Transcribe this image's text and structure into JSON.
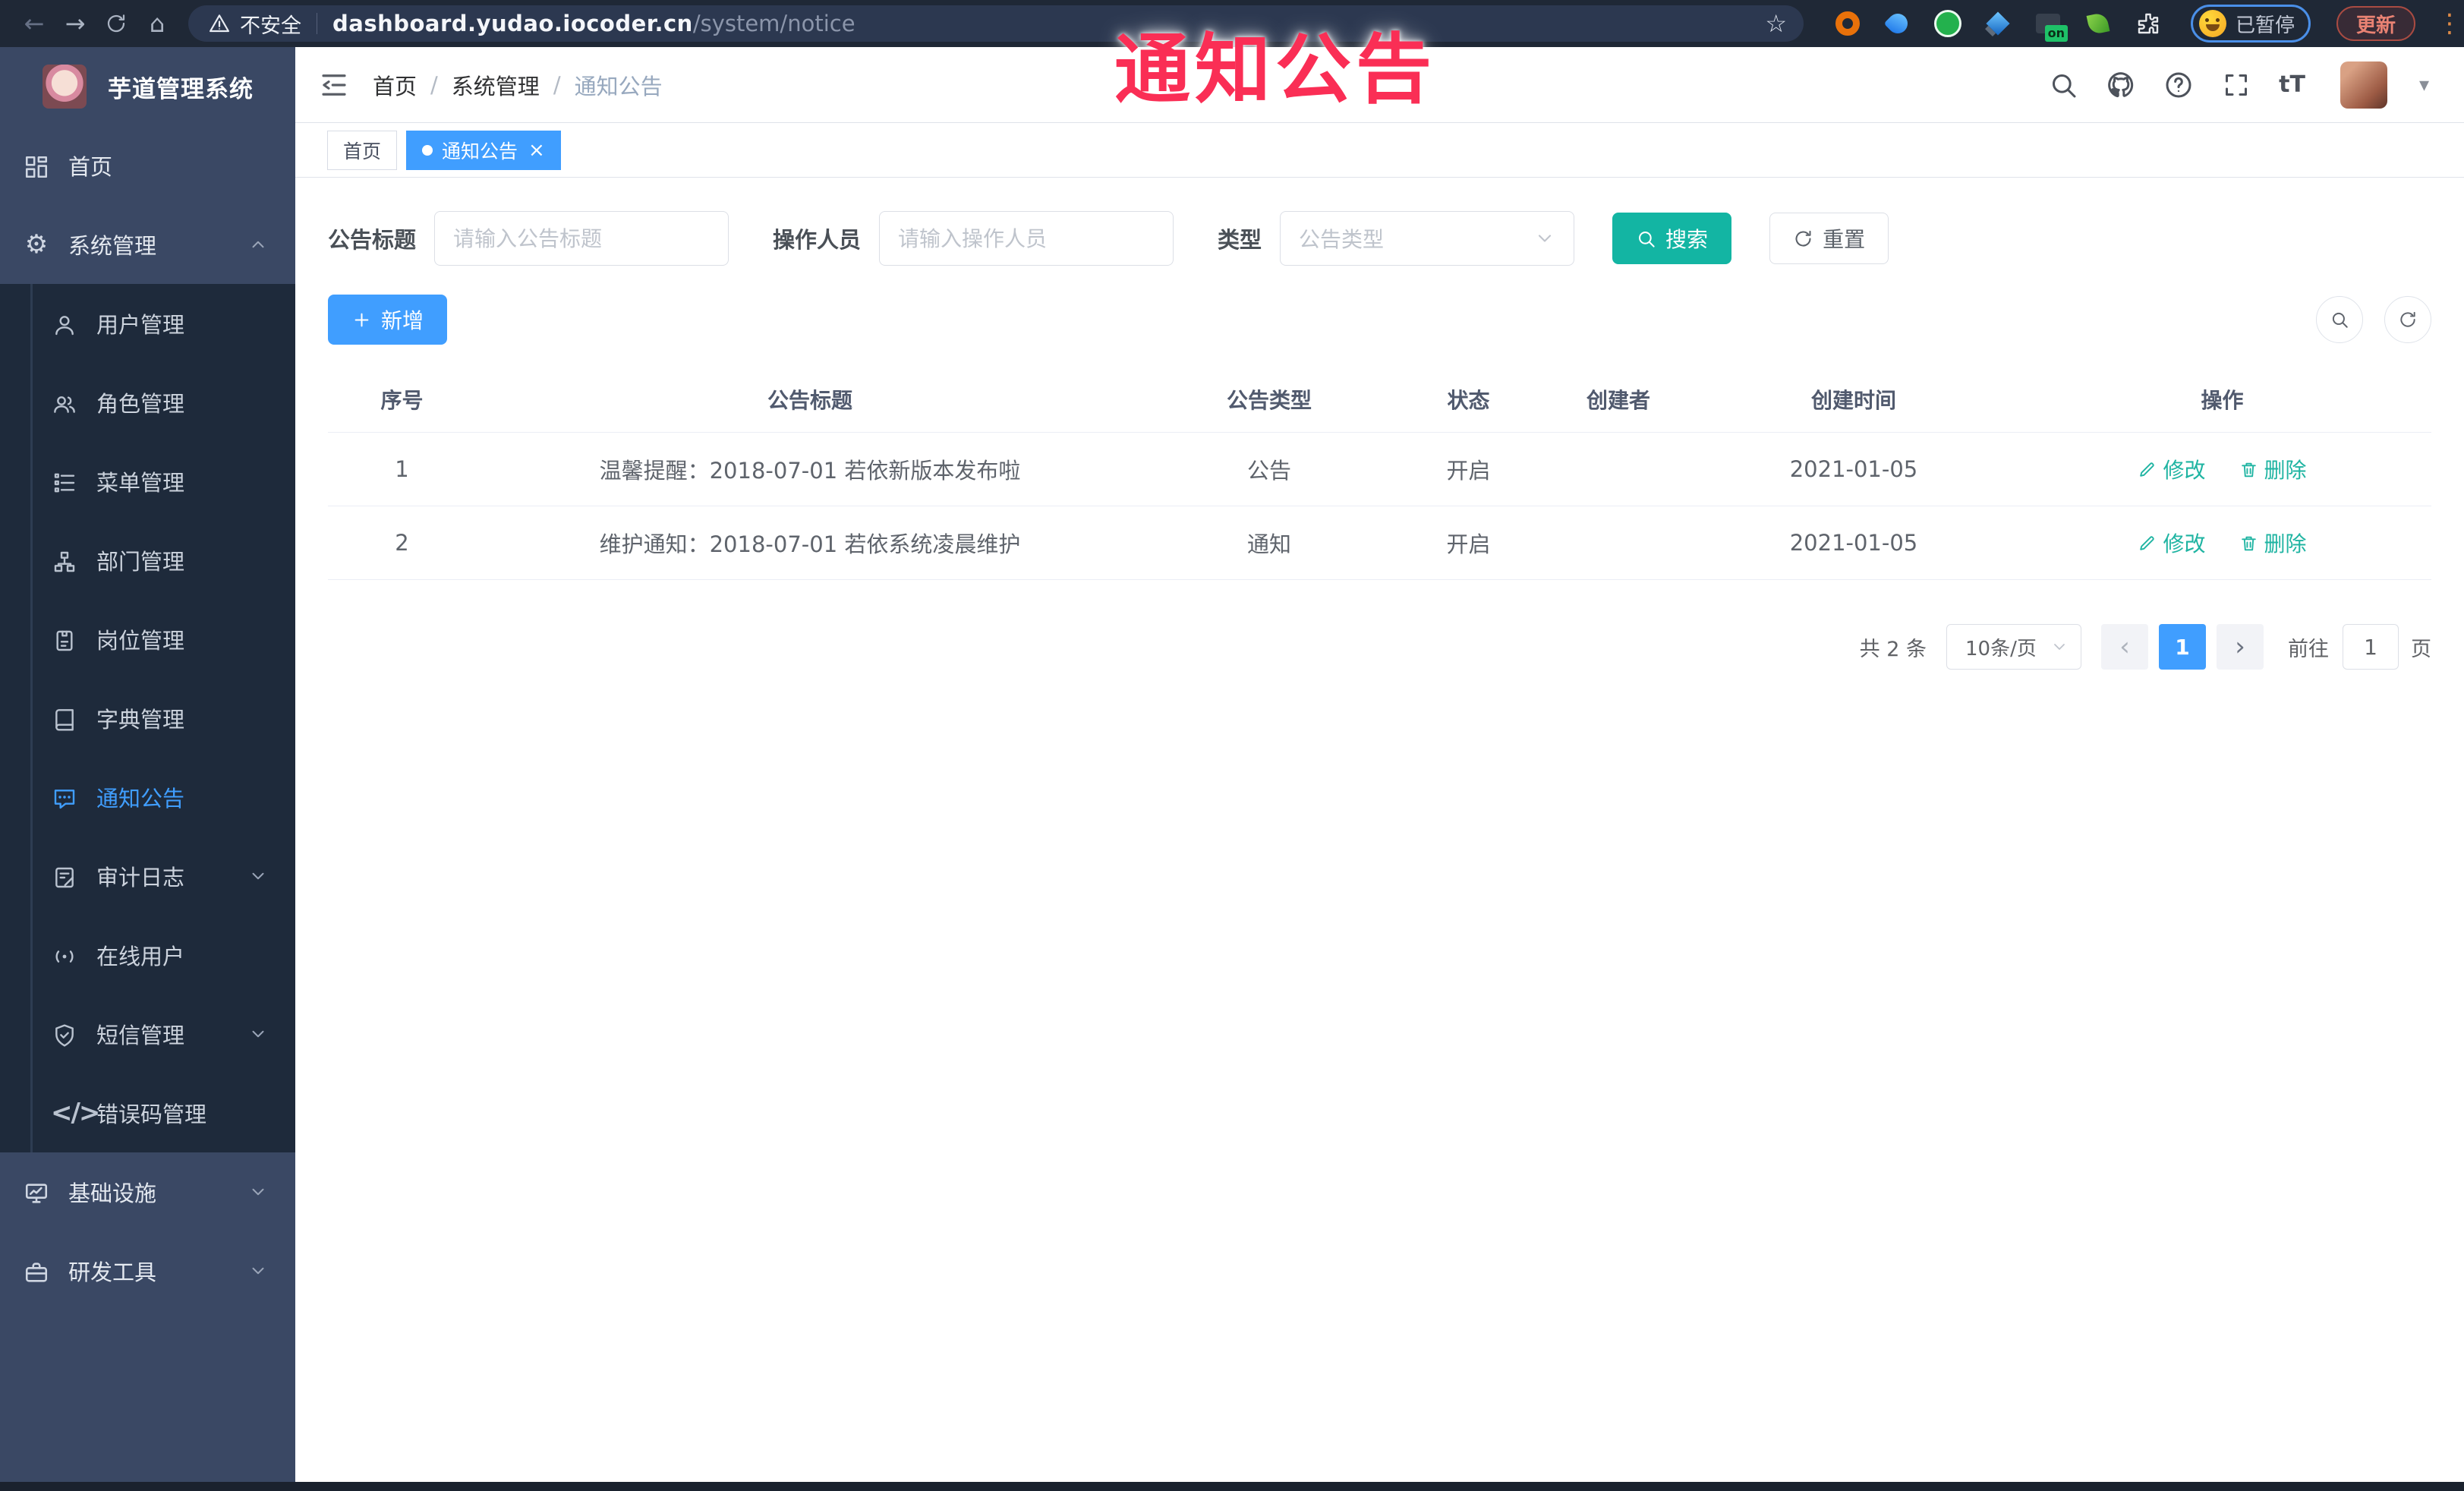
{
  "overlay": {
    "annotation": "通知公告"
  },
  "browser": {
    "security_label": "不安全",
    "url_host": "dashboard.yudao.iocoder.cn",
    "url_path": "/system/notice",
    "extension_badge": "on",
    "profile_chip_label": "已暂停",
    "update_label": "更新"
  },
  "icons": {
    "back": "←",
    "forward": "→",
    "home": "⌂",
    "star": "☆",
    "kebab": "⋮",
    "gear": "⚙",
    "caret_down": "▾",
    "close": "×",
    "dot": "",
    "prev": "‹",
    "next": "›",
    "text_size": "tT",
    "question": "?",
    "code": "</>"
  },
  "sidebar": {
    "app_title": "芋道管理系统",
    "items": [
      {
        "label": "首页"
      },
      {
        "label": "系统管理"
      },
      {
        "label": "用户管理"
      },
      {
        "label": "角色管理"
      },
      {
        "label": "菜单管理"
      },
      {
        "label": "部门管理"
      },
      {
        "label": "岗位管理"
      },
      {
        "label": "字典管理"
      },
      {
        "label": "通知公告"
      },
      {
        "label": "审计日志"
      },
      {
        "label": "在线用户"
      },
      {
        "label": "短信管理"
      },
      {
        "label": "错误码管理"
      },
      {
        "label": "基础设施"
      },
      {
        "label": "研发工具"
      }
    ]
  },
  "header": {
    "breadcrumb": [
      "首页",
      "系统管理",
      "通知公告"
    ]
  },
  "tabs": [
    {
      "label": "首页"
    },
    {
      "label": "通知公告"
    }
  ],
  "filters": {
    "title_label": "公告标题",
    "title_placeholder": "请输入公告标题",
    "operator_label": "操作人员",
    "operator_placeholder": "请输入操作人员",
    "type_label": "类型",
    "type_placeholder": "公告类型",
    "search_label": "搜索",
    "reset_label": "重置"
  },
  "toolbar": {
    "add_label": "新增"
  },
  "table": {
    "columns": [
      "序号",
      "公告标题",
      "公告类型",
      "状态",
      "创建者",
      "创建时间",
      "操作"
    ],
    "rows": [
      {
        "no": "1",
        "title": "温馨提醒：2018-07-01 若依新版本发布啦",
        "type": "公告",
        "status": "开启",
        "creator": "",
        "created": "2021-01-05"
      },
      {
        "no": "2",
        "title": "维护通知：2018-07-01 若依系统凌晨维护",
        "type": "通知",
        "status": "开启",
        "creator": "",
        "created": "2021-01-05"
      }
    ],
    "edit_label": "修改",
    "delete_label": "删除"
  },
  "pagination": {
    "total_text": "共 2 条",
    "page_size": "10条/页",
    "current_page": "1",
    "goto_label": "前往",
    "goto_value": "1",
    "page_unit": "页"
  },
  "colors": {
    "primary_blue": "#409eff",
    "teal": "#13b5a3",
    "link_teal": "#1fb4a2",
    "annotation_red": "#fa2e55",
    "sidebar_bg": "#3a4864",
    "submenu_bg": "#1e2a3b",
    "chrome_bg": "#1f2836"
  }
}
